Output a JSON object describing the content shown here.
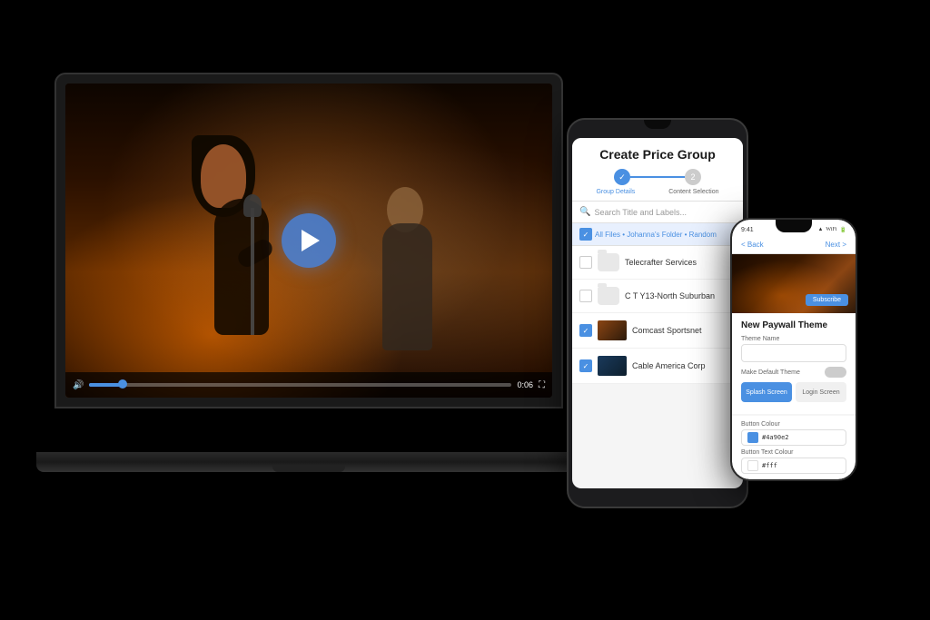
{
  "scene": {
    "background": "#000000"
  },
  "laptop": {
    "video": {
      "time_current": "0:06",
      "time_total": "0:06"
    }
  },
  "tablet": {
    "title": "Create Price Group",
    "steps": [
      {
        "label": "Group Details",
        "number": "1",
        "active": true
      },
      {
        "label": "Content Selection",
        "number": "2",
        "active": false
      }
    ],
    "search_placeholder": "Search Title and Labels...",
    "breadcrumb": "All Files • Johanna's Folder • Random",
    "list_items": [
      {
        "name": "Telecrafter Services",
        "type": "folder",
        "checked": false
      },
      {
        "name": "C T Y13-North Suburban",
        "type": "folder",
        "checked": false
      },
      {
        "name": "Comcast Sportsnet",
        "type": "video",
        "checked": true
      },
      {
        "name": "Cable America Corp",
        "type": "video",
        "checked": true
      }
    ]
  },
  "phone": {
    "status_time": "9:41",
    "nav": {
      "back_label": "< Back",
      "title": "",
      "action_label": "Next >"
    },
    "form": {
      "section_title": "New Paywall Theme",
      "theme_name_label": "Theme Name",
      "make_default_label": "Make Default Theme",
      "button_color_label": "Button Colour",
      "button_text_color_label": "Button Text Colour",
      "button_color_value": "#4a90e2",
      "button_text_color_value": "#fff",
      "splash_screen_label": "Splash Screen",
      "login_screen_label": "Login Screen"
    }
  }
}
